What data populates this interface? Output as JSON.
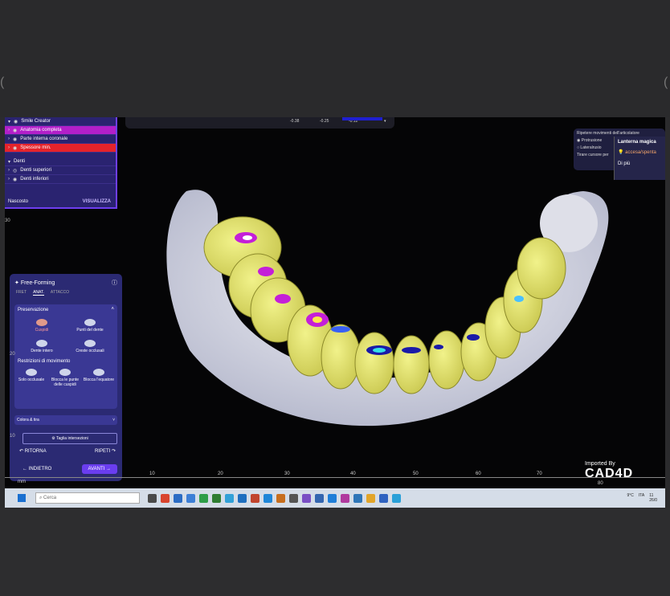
{
  "app": {
    "scene_panel": {
      "items": [
        {
          "label": "Smile Creator",
          "style": "plain"
        },
        {
          "label": "Anatomia completa",
          "style": "magenta"
        },
        {
          "label": "Parte interna coronale",
          "style": "plain"
        },
        {
          "label": "Spessore min.",
          "style": "red"
        },
        {
          "label": "Denti",
          "style": "plain"
        },
        {
          "label": "Denti superiori",
          "style": "plain"
        },
        {
          "label": "Denti inferiori",
          "style": "plain"
        }
      ],
      "footer_left": "Nascosto",
      "footer_right": "VISUALIZZA"
    },
    "measure_bar": {
      "values": [
        "-0.38",
        "-0.25",
        "-0.12"
      ]
    },
    "right_panel": {
      "title": "Ripetere movimenti dell'articolatore",
      "opt1": "Protrusione",
      "opt2": "Lateralrusio",
      "opt3": "Tirare cursore per"
    },
    "lantern": {
      "title": "Lanterna magica",
      "toggle": "accesa/spenta",
      "more": "Di più"
    },
    "free_forming": {
      "title": "Free-Forming",
      "tabs": [
        "FRET",
        "ANAT.",
        "ATTACCO"
      ],
      "active_tab": 1,
      "preservation_label": "Preservazione",
      "grid": [
        {
          "label": "Cuspidi",
          "selected": true
        },
        {
          "label": "Punti del dente",
          "selected": false
        },
        {
          "label": "Dente intero",
          "selected": false
        },
        {
          "label": "Creste occlusali",
          "selected": false
        }
      ],
      "restrictions_label": "Restrizioni di movimento",
      "restrictions": [
        "Solo occlusale",
        "Blocca le punte delle cuspidi",
        "Blocca l'equatore"
      ],
      "color_label": "Colora & tira",
      "taglia": "Taglia intersezioni",
      "undo": "RITORNA",
      "redo": "RIPETI",
      "back": "INDIETRO",
      "next": "AVANTI"
    },
    "ruler": {
      "unit": "mm",
      "ticks": [
        "10",
        "20",
        "30",
        "40",
        "50",
        "60",
        "70",
        "80"
      ]
    },
    "y_labels": [
      "30",
      "20",
      "10",
      "0"
    ],
    "watermark": {
      "small": "Imported By",
      "big": "CAD4D"
    },
    "taskbar": {
      "search_placeholder": "Cerca",
      "temp": "9°C",
      "lang": "ITA",
      "time": "11",
      "date": "26/0"
    },
    "edge_chars": {
      "left": "(",
      "right": "("
    }
  }
}
